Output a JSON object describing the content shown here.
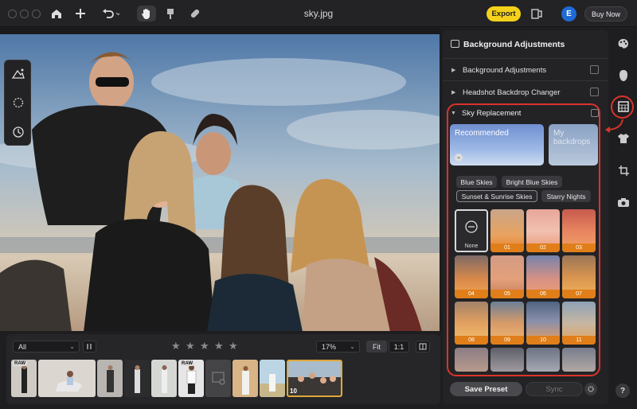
{
  "window": {
    "title": "sky.jpg"
  },
  "toolbar": {
    "export_label": "Export",
    "avatar_letter": "E",
    "buy_label": "Buy Now"
  },
  "filmstrip": {
    "filter_value": "All",
    "zoom_value": "17%",
    "fit_label": "Fit",
    "one_to_one_label": "1:1",
    "rating_stars": 5,
    "raw_badge": "RAW",
    "selected_count": "10"
  },
  "panel": {
    "header": "Background Adjustments",
    "sections": [
      {
        "label": "Background Adjustments"
      },
      {
        "label": "Headshot Backdrop Changer"
      }
    ],
    "sky": {
      "title": "Sky Replacement",
      "cards": [
        {
          "label": "Recommended"
        },
        {
          "label": "My backdrops"
        }
      ],
      "chips": [
        "Blue Skies",
        "Bright Blue Skies",
        "Sunset & Sunrise Skies",
        "Starry Nights"
      ],
      "active_chip": "Sunset & Sunrise Skies",
      "tiles": [
        "None",
        "01",
        "02",
        "03",
        "04",
        "05",
        "06",
        "07",
        "08",
        "09",
        "10",
        "11"
      ]
    },
    "save_preset_label": "Save Preset",
    "sync_label": "Sync"
  },
  "rail": {
    "help_label": "?"
  },
  "colors": {
    "accent_yellow": "#f5d21a",
    "highlight_red": "#d9342b",
    "tile_label_orange": "#e07e1a",
    "avatar_blue": "#1e6bd6"
  }
}
